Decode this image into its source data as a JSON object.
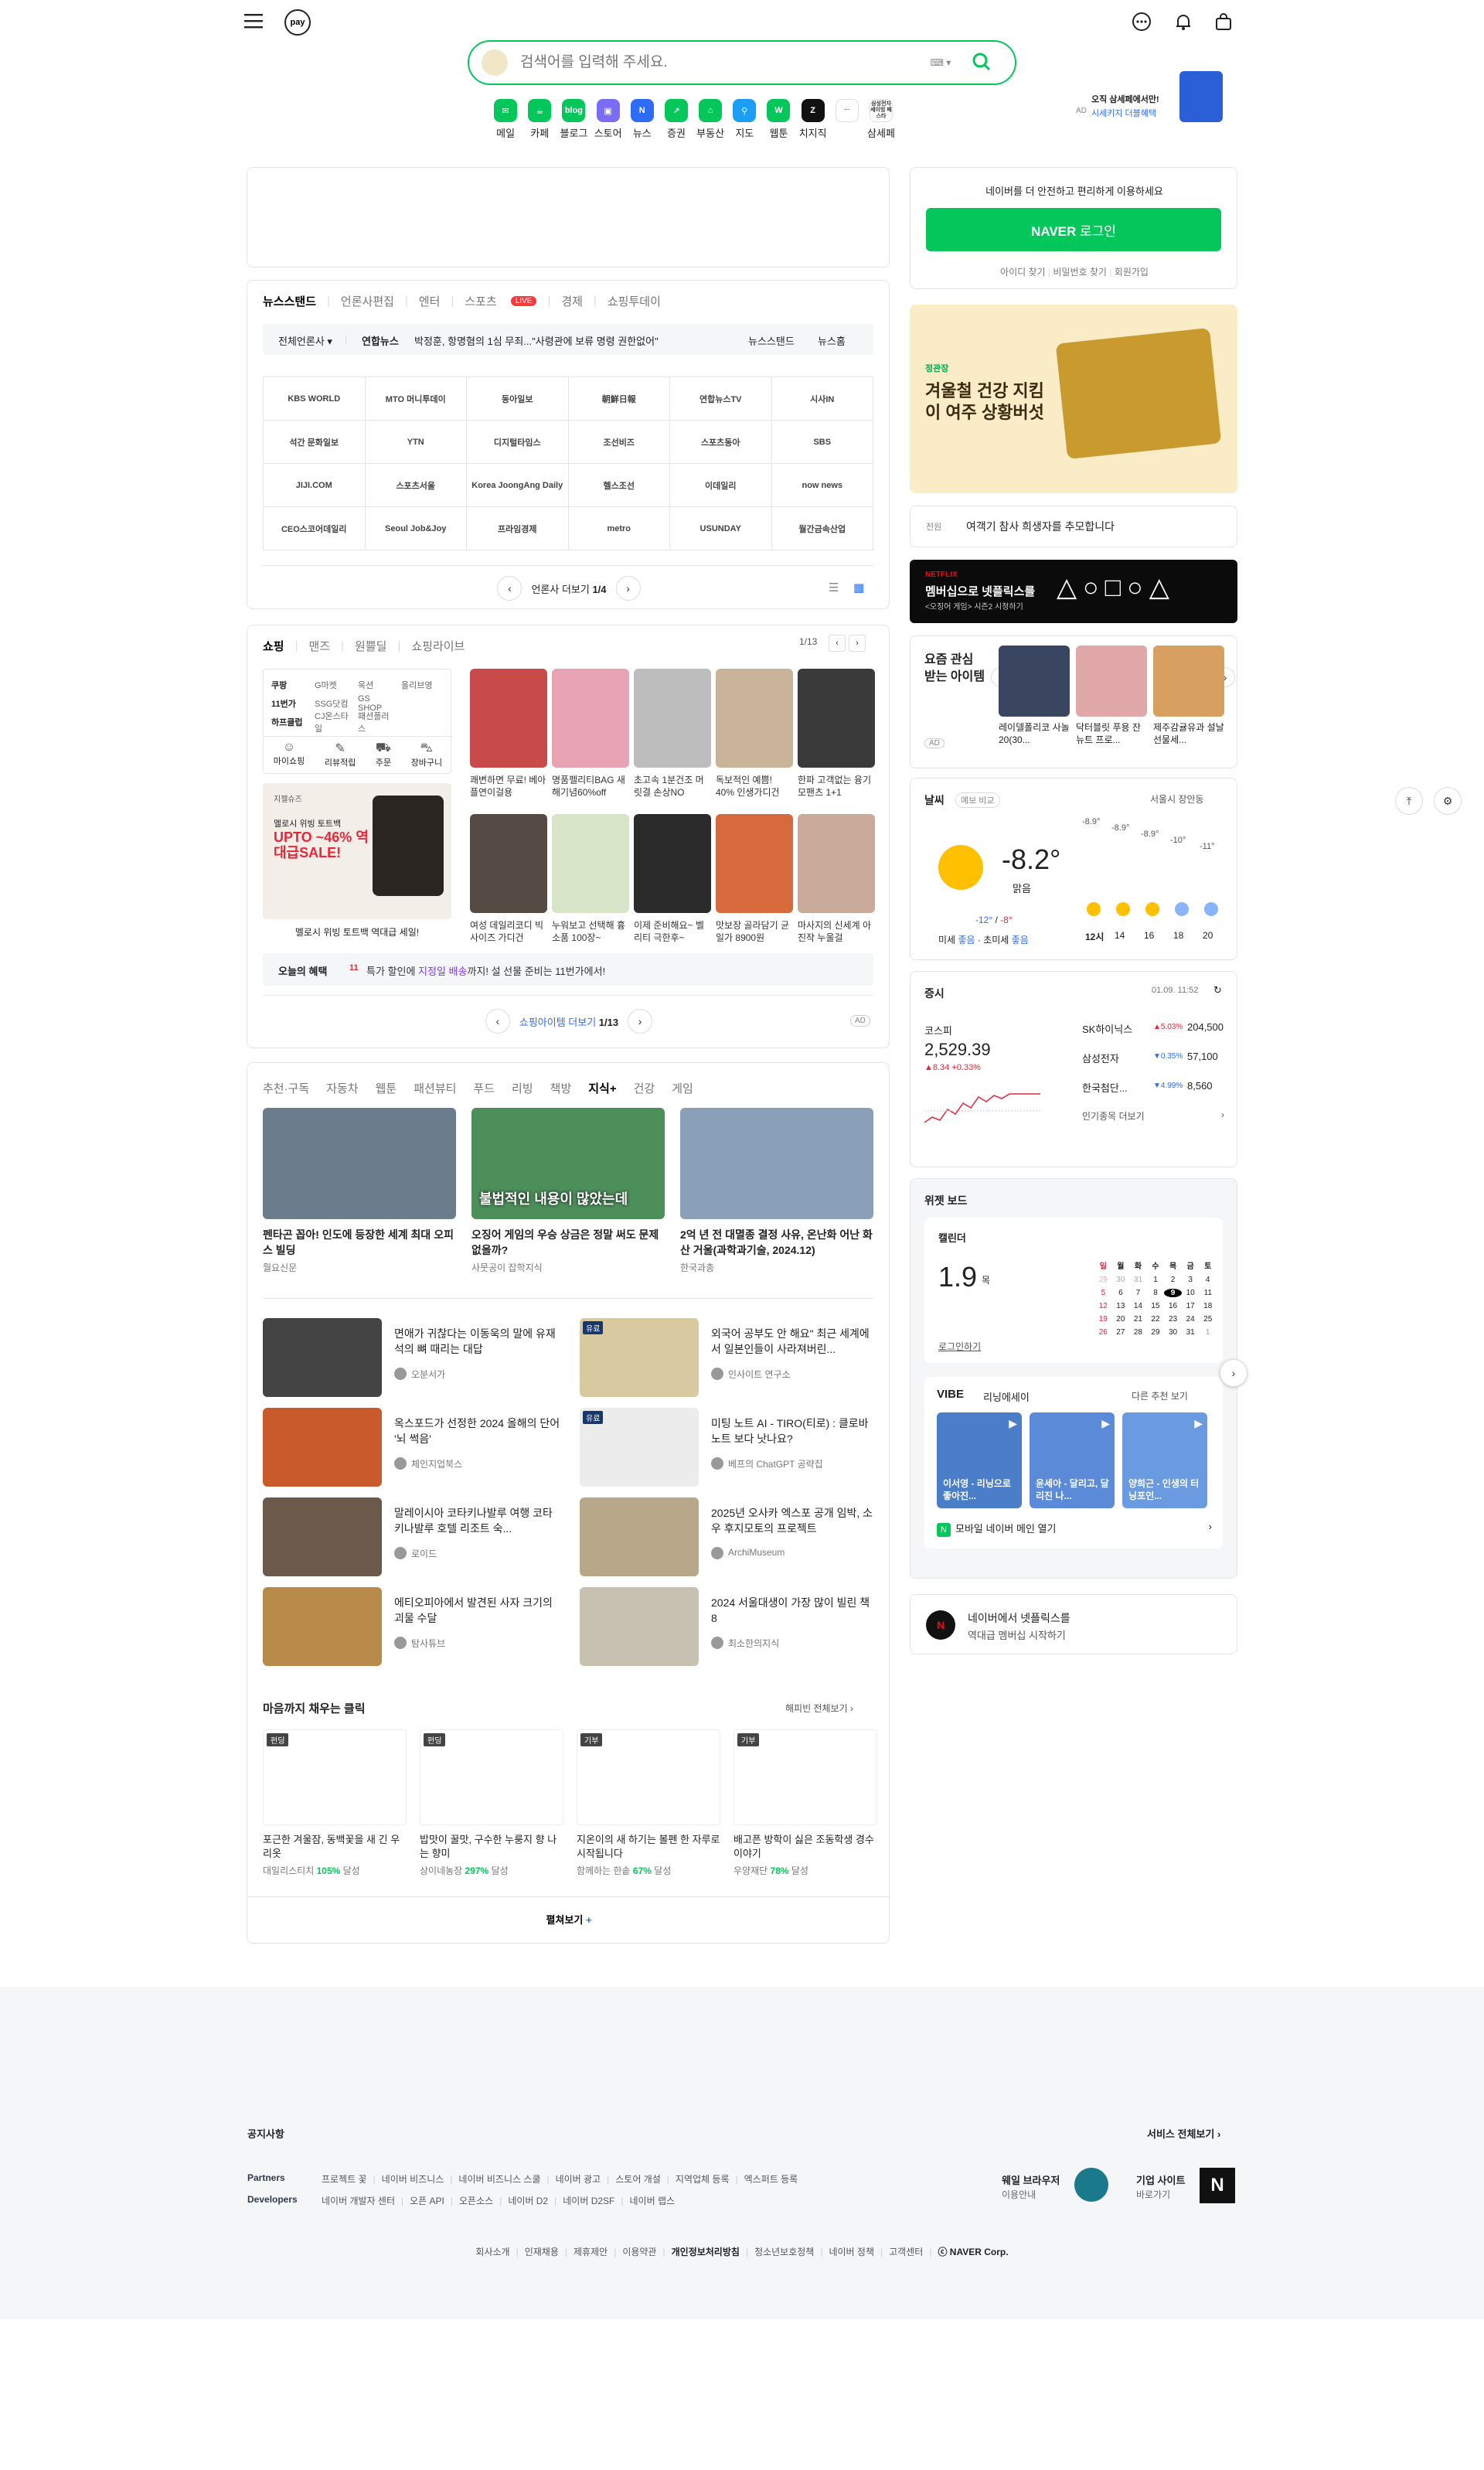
{
  "header": {
    "pay_label": "pay",
    "search_placeholder": "검색어를 입력해 주세요.",
    "ad_label": "AD",
    "ad_text_1": "오직 삼세페에서만!",
    "ad_text_2": "시세키지 더블혜택",
    "ad_brand": "삼성전자 제이더블 재스트",
    "shortcuts": [
      {
        "label": "메일",
        "icon": "mail-icon",
        "color": "#03c75a",
        "glyph": "✉"
      },
      {
        "label": "카페",
        "icon": "cafe-icon",
        "color": "#03c75a",
        "glyph": "☕"
      },
      {
        "label": "블로그",
        "icon": "blog-icon",
        "color": "#03c75a",
        "glyph": "blog"
      },
      {
        "label": "스토어",
        "icon": "store-icon",
        "color": "#7b6cf6",
        "glyph": "▣"
      },
      {
        "label": "뉴스",
        "icon": "news-icon",
        "color": "#2d6cf6",
        "glyph": "N"
      },
      {
        "label": "증권",
        "icon": "stock-icon",
        "color": "#03c75a",
        "glyph": "↗"
      },
      {
        "label": "부동산",
        "icon": "realestate-icon",
        "color": "#03c75a",
        "glyph": "⌂"
      },
      {
        "label": "지도",
        "icon": "map-icon",
        "color": "#1a9ef6",
        "glyph": "⚲"
      },
      {
        "label": "웹툰",
        "icon": "webtoon-icon",
        "color": "#03c75a",
        "glyph": "W"
      },
      {
        "label": "치지직",
        "icon": "chzzk-icon",
        "color": "#111111",
        "glyph": "Z"
      },
      {
        "label": "",
        "icon": "more-icon",
        "color": "#ffffff",
        "glyph": "···"
      },
      {
        "label": "삼세페",
        "icon": "samsepe-icon",
        "color": "#ffffff",
        "glyph": "삼성전자 세이빙 페스타"
      }
    ]
  },
  "newsstand": {
    "tabs": [
      "뉴스스탠드",
      "언론사편집",
      "엔터",
      "스포츠",
      "경제",
      "쇼핑투데이"
    ],
    "live_badge": "LIVE",
    "filter": "전체언론사",
    "headline_source": "연합뉴스",
    "headline": "박정훈, 항명혐의 1심 무죄...\"사령관에 보류 명령 권한없어\"",
    "right_links": [
      "뉴스스탠드",
      "뉴스홈"
    ],
    "press": [
      "KBS WORLD",
      "MTO 머니투데이",
      "동아일보",
      "朝鮮日報",
      "연합뉴스TV",
      "시사IN",
      "석간 문화일보",
      "YTN",
      "디지털타임스",
      "조선비즈",
      "스포츠동아",
      "SBS",
      "JIJI.COM",
      "스포츠서울",
      "Korea JoongAng Daily",
      "헬스조선",
      "이데일리",
      "now news",
      "CEO스코어데일리",
      "Seoul Job&Joy",
      "프라임경제",
      "metro",
      "USUNDAY",
      "월간금속산업"
    ],
    "pager_label": "언론사 더보기",
    "pager_page": "1/4"
  },
  "shopping": {
    "tabs": [
      "쇼핑",
      "맨즈",
      "원쁠딜",
      "쇼핑라이브"
    ],
    "page": "1/13",
    "menu_rows": [
      [
        "쿠팡",
        "G마켓",
        "옥션",
        "올리브영"
      ],
      [
        "11번가",
        "SSG닷컴",
        "GS SHOP"
      ],
      [
        "하프클럽",
        "CJ온스타일",
        "패션플러스"
      ]
    ],
    "menu_icons": [
      {
        "label": "마이쇼핑",
        "icon": "user-icon"
      },
      {
        "label": "리뷰적립",
        "icon": "review-icon"
      },
      {
        "label": "주문",
        "icon": "truck-icon"
      },
      {
        "label": "장바구니",
        "icon": "cart-icon"
      }
    ],
    "promo_brand": "지젤슈즈",
    "promo_title": "멜로시 위빙 토트백",
    "promo_sale": "UPTO ~46% 역대급SALE!",
    "promo_caption": "멜로시 위빙 토트백 역대급 세일!",
    "products": [
      {
        "t": "쾌변하면 무료! 베아플연이걸용",
        "c": "#c84a4a"
      },
      {
        "t": "명품펠리티BAG 새해기념60%off",
        "c": "#e8a4b4"
      },
      {
        "t": "초고속 1분건조 머릿결 손상NO",
        "c": "#bdbdbd"
      },
      {
        "t": "독보적인 예쁨! 40% 인생가디건",
        "c": "#c9b49a"
      },
      {
        "t": "한파 고객없는 융기모팬츠 1+1",
        "c": "#3a3a3a"
      },
      {
        "t": "여성 데일리코디 빅사이즈 가디건",
        "c": "#554a44"
      },
      {
        "t": "누워보고 선택해 흉소품 100장~",
        "c": "#d8e4c8"
      },
      {
        "t": "이제 준비해요~ 벨리티 극한후~",
        "c": "#2b2b2b"
      },
      {
        "t": "맛보장 골라담기 균일가 8900원",
        "c": "#d66a3c"
      },
      {
        "t": "마사지의 신세계 아 진작 누울걸",
        "c": "#c9a99a"
      }
    ],
    "benefit_label": "오늘의 혜택",
    "benefit_text": "특가 할인에 지정일 배송까지! 설 선물 준비는 11번가에서!",
    "benefit_link": "지정일 배송",
    "pager_label": "쇼핑아이템 더보기",
    "pager_page": "1/13",
    "ad": "AD"
  },
  "content": {
    "tabs": [
      "추천·구독",
      "자동차",
      "웹툰",
      "패션뷰티",
      "푸드",
      "리빙",
      "책방",
      "지식+",
      "건강",
      "게임"
    ],
    "active_tab": "지식+",
    "big": [
      {
        "t": "펜타곤 꼽아! 인도에 등장한 세계 최대 오피스 빌딩",
        "s": "월요신문",
        "c": "#6b7d8c"
      },
      {
        "t": "오징어 게임의 우승 상금은 정말 써도 문제없을까?",
        "s": "사뭇공이 잡학지식",
        "c": "#4d8f5a",
        "overlay": "불법적인 내용이 많았는데"
      },
      {
        "t": "2억 년 전 대멸종 결정 사유, 온난화 어난 화산 거울(과학과기술, 2024.12)",
        "s": "한국과총",
        "c": "#8aa0b8"
      }
    ],
    "list": [
      {
        "t": "면애가 귀찮다는 이동욱의 말에 유재석의 뼈 때리는 대답",
        "s": "오분서가",
        "c": "#444"
      },
      {
        "t": "외국어 공부도 안 해요\" 최근 세계에서 일본인들이 사라져버린...",
        "s": "인사이트 연구소",
        "c": "#d9c9a0",
        "badge": "유료"
      },
      {
        "t": "옥스포드가 선정한 2024 올해의 단어 '뇌 썩음'",
        "s": "체인지업북스",
        "c": "#c85a2c"
      },
      {
        "t": "미팅 노트 AI - TIRO(티로) : 클로바노트 보다 낫나요?",
        "s": "베프의 ChatGPT 공략집",
        "c": "#ececec",
        "badge": "유료"
      },
      {
        "t": "말레이시아 코타키나발루 여행 코타키나발루 호텔 리조트 숙...",
        "s": "로이드",
        "c": "#6b5a4a"
      },
      {
        "t": "2025년 오사카 엑스포 공개 임박, 소우 후지모토의 프로젝트",
        "s": "ArchiMuseum",
        "c": "#b8a88a"
      },
      {
        "t": "에티오피아에서 발견된 사자 크기의 괴물 수달",
        "s": "탐사튜브",
        "c": "#b88a4a"
      },
      {
        "t": "2024 서울대생이 가장 많이 빌린 책 8",
        "s": "최소한의지식",
        "c": "#c8c0b0"
      }
    ],
    "charity_title": "마음까지 채우는 클릭",
    "charity_link": "해피빈 전체보기",
    "charity": [
      {
        "b": "펀딩",
        "t": "포근한 겨울잠, 동백꽃을 새 긴 우리옷",
        "s": "대일리스티치",
        "p": "105%",
        "d": "달성"
      },
      {
        "b": "펀딩",
        "t": "밥맛이 꿀맛, 구수한 누룽지 향 나는 향미",
        "s": "상이네농장",
        "p": "297%",
        "d": "달성"
      },
      {
        "b": "기부",
        "t": "지온이의 새 하기는 볼펜 한 자루로 시작됩니다",
        "s": "함께하는 한솥",
        "p": "67%",
        "d": "달성"
      },
      {
        "b": "기부",
        "t": "배고픈 방학이 싫은 조동학생 경수 이야기",
        "s": "우양재단",
        "p": "78%",
        "d": "달성"
      }
    ],
    "more": "펼쳐보기"
  },
  "right": {
    "login_text": "네이버를 더 안전하고 편리하게 이용하세요",
    "login_btn_logo": "NAVER",
    "login_btn": "로그인",
    "login_links": [
      "아이디 찾기",
      "비밀번호 찾기",
      "회원가입"
    ],
    "ad_brand": "정관장",
    "ad_title": "겨울철 건강 지킴이 여주 상황버섯",
    "notice_brand": "전원",
    "notice_text": "여객기 참사 희생자를 추모합니다",
    "netflix_tag": "NETFLIX",
    "netflix_title": "멤버십으로 넷플릭스를",
    "netflix_sub": "<오징어 게임> 시즌2 시청하기",
    "interest_title": "요즘 관심 받는 아이템",
    "interest_ad": "AD",
    "interest_items": [
      {
        "t": "레이델폴리코 사놀20(30...",
        "c": "#3a4660"
      },
      {
        "t": "닥터블릿 푸용 잔 뉴트 프로...",
        "c": "#e0a8a8"
      },
      {
        "t": "제주감귤유과 설날 선물세...",
        "c": "#d8a060"
      }
    ],
    "weather": {
      "title": "날씨",
      "tag": "예보 비교",
      "location": "서울시 장안동",
      "temp": "-8.2°",
      "cond": "맑음",
      "low": "-12°",
      "high": "-8°",
      "dust_label": "미세",
      "dust": "좋음",
      "ufine_label": "초미세",
      "ufine": "좋음",
      "hours": [
        "12시",
        "14",
        "16",
        "18",
        "20"
      ],
      "hour_temps": [
        "-8.9°",
        "-8.9°",
        "-8.9°",
        "-10°",
        "-11°"
      ]
    },
    "stock": {
      "title": "증시",
      "time": "01.09. 11:52",
      "kospi_label": "코스피",
      "kospi": "2,529.39",
      "kospi_chg": "▲8.34  +0.33%",
      "items": [
        {
          "n": "SK하이닉스",
          "c": "▲5.03%",
          "v": "204,500",
          "up": true
        },
        {
          "n": "삼성전자",
          "c": "▼0.35%",
          "v": "57,100",
          "up": false
        },
        {
          "n": "한국첨단...",
          "c": "▼4.99%",
          "v": "8,560",
          "up": false
        }
      ],
      "more": "인기종목 더보기"
    },
    "widget": {
      "title": "위젯 보드",
      "calendar_label": "캘린더",
      "day": "1.9",
      "dow": "목",
      "login": "로그인하기",
      "week_head": [
        "일",
        "월",
        "화",
        "수",
        "목",
        "금",
        "토"
      ],
      "weeks": [
        [
          "29",
          "30",
          "31",
          "1",
          "2",
          "3",
          "4"
        ],
        [
          "5",
          "6",
          "7",
          "8",
          "9",
          "10",
          "11"
        ],
        [
          "12",
          "13",
          "14",
          "15",
          "16",
          "17",
          "18"
        ],
        [
          "19",
          "20",
          "21",
          "22",
          "23",
          "24",
          "25"
        ],
        [
          "26",
          "27",
          "28",
          "29",
          "30",
          "31",
          "1"
        ]
      ],
      "vibe": "VIBE",
      "vibe_sub": "리닝에세이",
      "vibe_more": "다른 추천 보기",
      "vibe_items": [
        {
          "t": "이서영 - 리닝으로 좋아진...",
          "c": "#4b7ec8"
        },
        {
          "t": "윤세아 - 달리고, 달리진 나...",
          "c": "#5a8ad8"
        },
        {
          "t": "양희근 - 인생의 터닝포인...",
          "c": "#6a9ae0"
        }
      ],
      "mobile": "모바일 네이버 메인 열기"
    },
    "netflix_card_1": "네이버에서 넷플릭스를",
    "netflix_card_2": "역대급 멤버십 시작하기"
  },
  "footer": {
    "notice": "공지사항",
    "all_services": "서비스 전체보기",
    "partners_label": "Partners",
    "partners": [
      "프로젝트 꽃",
      "네이버 비즈니스",
      "네이버 비즈니스 스쿨",
      "네이버 광고",
      "스토어 개설",
      "지역업체 등록",
      "엑스퍼트 등록"
    ],
    "devs_label": "Developers",
    "devs": [
      "네이버 개발자 센터",
      "오픈 API",
      "오픈소스",
      "네이버 D2",
      "네이버 D2SF",
      "네이버 랩스"
    ],
    "whale_1": "웨일 브라우저",
    "whale_2": "이용안내",
    "corp_1": "기업 사이트",
    "corp_2": "바로가기",
    "bottom": [
      "회사소개",
      "인재채용",
      "제휴제안",
      "이용약관",
      "개인정보처리방침",
      "청소년보호정책",
      "네이버 정책",
      "고객센터"
    ],
    "copyright": "ⓒ NAVER Corp."
  }
}
